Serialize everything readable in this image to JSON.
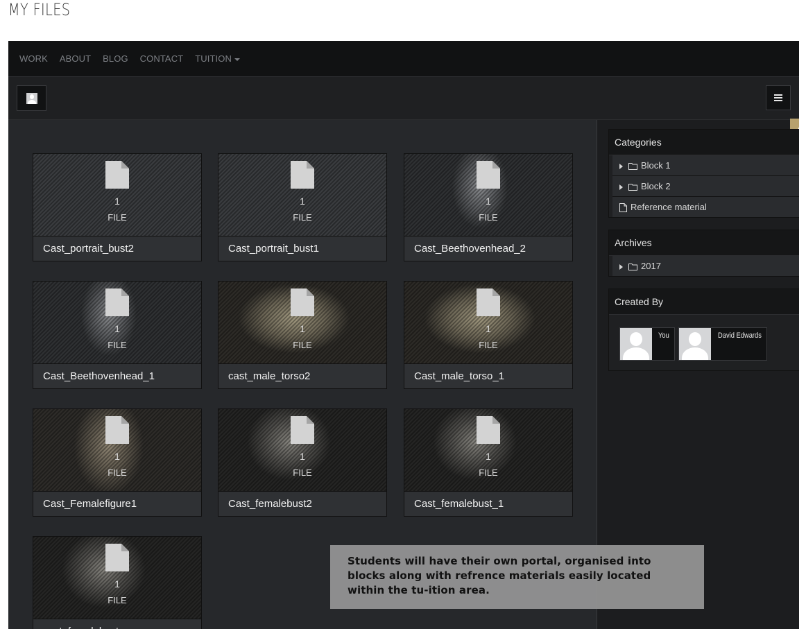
{
  "page_title": "MY FILES",
  "nav": {
    "items": [
      "WORK",
      "ABOUT",
      "BLOG",
      "CONTACT",
      "TUITION"
    ]
  },
  "toolbar": {
    "avatar_icon": "user-avatar-icon",
    "list_view_icon": "list-icon",
    "grid_view_icon": "grid-icon",
    "active_view": "grid",
    "accent_color": "#b7a16e"
  },
  "folders": [
    {
      "name": "Cast_portrait_bust2",
      "count": "1",
      "unit": "FILE",
      "thumb": "none"
    },
    {
      "name": "Cast_portrait_bust1",
      "count": "1",
      "unit": "FILE",
      "thumb": "none"
    },
    {
      "name": "Cast_Beethovenhead_2",
      "count": "1",
      "unit": "FILE",
      "thumb": "face-gray"
    },
    {
      "name": "Cast_Beethovenhead_1",
      "count": "1",
      "unit": "FILE",
      "thumb": "face-gray"
    },
    {
      "name": "cast_male_torso2",
      "count": "1",
      "unit": "FILE",
      "thumb": "torso-warm"
    },
    {
      "name": "Cast_male_torso_1",
      "count": "1",
      "unit": "FILE",
      "thumb": "torso-warm"
    },
    {
      "name": "Cast_Femalefigure1",
      "count": "1",
      "unit": "FILE",
      "thumb": "figure-warm"
    },
    {
      "name": "Cast_femalebust2",
      "count": "1",
      "unit": "FILE",
      "thumb": "bust-dark"
    },
    {
      "name": "Cast_femalebust_1",
      "count": "1",
      "unit": "FILE",
      "thumb": "bust-dark"
    },
    {
      "name": "cast_femalebust",
      "count": "1",
      "unit": "FILE",
      "thumb": "bust-dark"
    }
  ],
  "sidebar": {
    "categories": {
      "title": "Categories",
      "items": [
        {
          "label": "Block 1",
          "type": "folder",
          "expandable": true
        },
        {
          "label": "Block 2",
          "type": "folder",
          "expandable": true
        },
        {
          "label": "Reference material",
          "type": "file",
          "expandable": false
        }
      ]
    },
    "archives": {
      "title": "Archives",
      "items": [
        {
          "label": "2017",
          "type": "folder",
          "expandable": true
        }
      ]
    },
    "created_by": {
      "title": "Created By",
      "users": [
        "You",
        "David Edwards"
      ]
    }
  },
  "note": {
    "text": "Students will have their own portal, organised into blocks along with refrence materials easily located within the tu-ition area."
  }
}
